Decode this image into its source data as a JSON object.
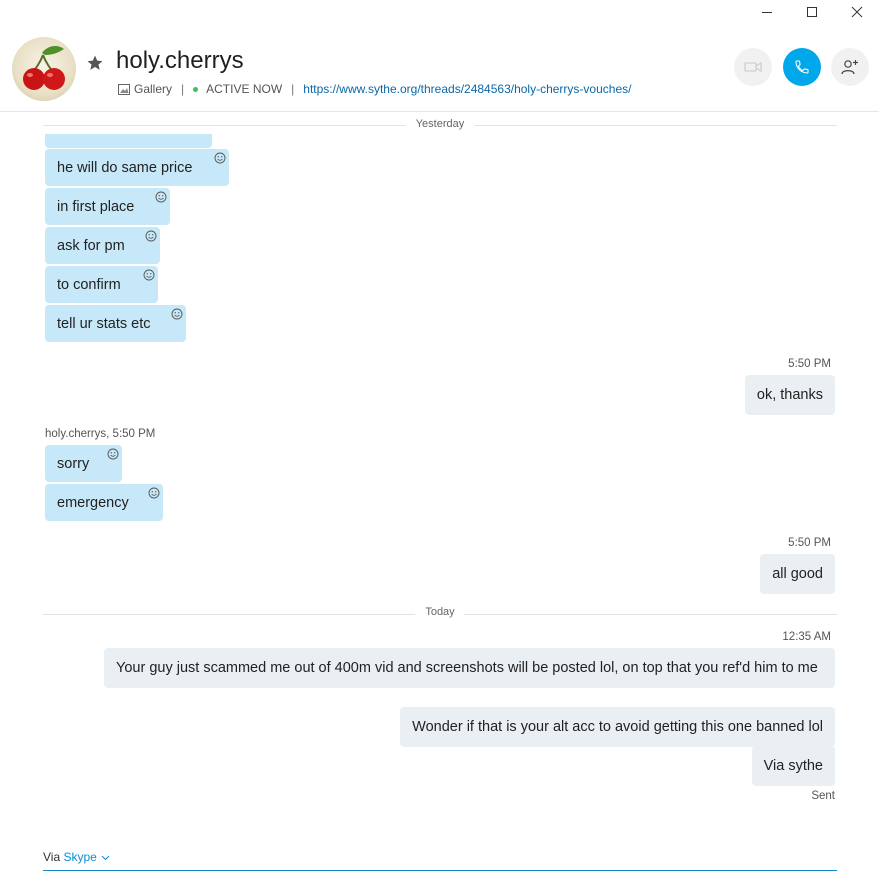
{
  "window": {
    "minimize_icon": "minimize-icon",
    "maximize_icon": "maximize-icon",
    "close_icon": "close-icon"
  },
  "header": {
    "contact_name": "holy.cherrys",
    "gallery_label": "Gallery",
    "separator": "|",
    "status": "ACTIVE NOW",
    "link": "https://www.sythe.org/threads/2484563/holy-cherrys-vouches/",
    "status_color": "#3ec160",
    "call_color": "#00a7ea"
  },
  "chat": {
    "day1": "Yesterday",
    "incoming_group1": [
      {
        "text": "he will do same price"
      },
      {
        "text": "in first place"
      },
      {
        "text": "ask for pm"
      },
      {
        "text": "to confirm"
      },
      {
        "text": "tell ur stats etc"
      }
    ],
    "outgoing_time1": "5:50 PM",
    "outgoing1": "ok, thanks",
    "sender_label": "holy.cherrys,",
    "sender_time": "5:50 PM",
    "incoming_group2": [
      {
        "text": "sorry"
      },
      {
        "text": "emergency"
      }
    ],
    "outgoing_time2": "5:50 PM",
    "outgoing2": "all good",
    "day2": "Today",
    "outgoing_time3": "12:35 AM",
    "outgoing3": "Your guy just scammed me out of 400m vid and screenshots will be posted lol, on top that you ref'd him to me",
    "outgoing4": "Wonder if that is your alt acc to avoid getting this one banned lol",
    "outgoing5": "Via sythe",
    "sent_label": "Sent"
  },
  "footer": {
    "via_label": "Via",
    "via_service": "Skype"
  }
}
